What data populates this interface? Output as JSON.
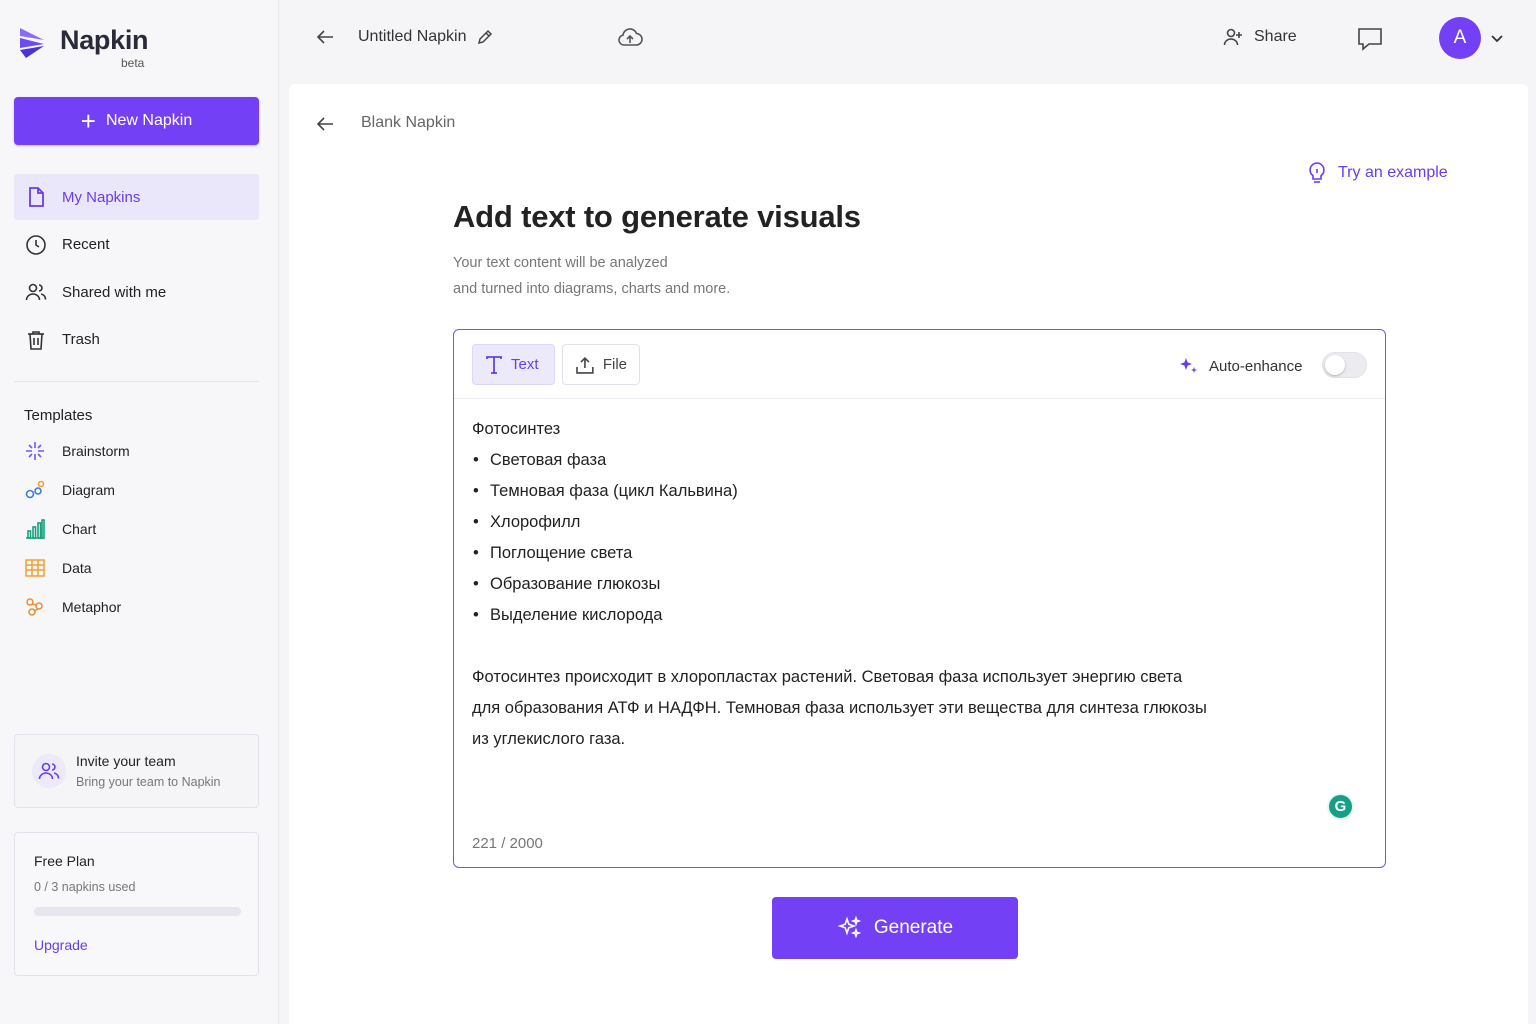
{
  "sidebar": {
    "logo": {
      "name": "Napkin",
      "badge": "beta"
    },
    "new_button": "New Napkin",
    "nav": [
      {
        "label": "My Napkins",
        "icon": "file-icon",
        "active": true
      },
      {
        "label": "Recent",
        "icon": "clock-icon"
      },
      {
        "label": "Shared with me",
        "icon": "users-icon"
      },
      {
        "label": "Trash",
        "icon": "trash-icon"
      }
    ],
    "templates": {
      "title": "Templates",
      "items": [
        {
          "label": "Brainstorm",
          "icon": "sparkle-icon",
          "color": "#6a5cf5"
        },
        {
          "label": "Diagram",
          "icon": "diagram-icon",
          "color": "#3a7fd6"
        },
        {
          "label": "Chart",
          "icon": "bar-chart-icon",
          "color": "#18a07a"
        },
        {
          "label": "Data",
          "icon": "table-icon",
          "color": "#f0a030"
        },
        {
          "label": "Metaphor",
          "icon": "metaphor-icon",
          "color": "#f08a30"
        }
      ]
    },
    "invite": {
      "title": "Invite your team",
      "subtitle": "Bring your team to Napkin"
    },
    "plan": {
      "title": "Free Plan",
      "usage": "0 / 3 napkins used",
      "progress": 0,
      "upgrade": "Upgrade"
    }
  },
  "topbar": {
    "doc_title": "Untitled Napkin",
    "share": "Share",
    "avatar_letter": "A"
  },
  "main": {
    "breadcrumb": "Blank Napkin",
    "try_example": "Try an example",
    "heading": "Add text to generate visuals",
    "sub_line1": "Your text content will be analyzed",
    "sub_line2": "and turned into diagrams, charts and more.",
    "editor": {
      "tab_text": "Text",
      "tab_file": "File",
      "auto_enhance": "Auto-enhance",
      "auto_enhance_on": false,
      "content": {
        "title": "Фотосинтез",
        "bullets": [
          "Световая фаза",
          "Темновая фаза (цикл Кальвина)",
          "Хлорофилл",
          "Поглощение света",
          "Образование глюкозы",
          "Выделение кислорода"
        ],
        "para_line1": "Фотосинтез происходит в хлоропластах растений. Световая фаза использует энергию света",
        "para_line2": "для образования АТФ и НАДФН. Темновая фаза использует эти вещества для синтеза глюкозы",
        "para_line3": "из углекислого газа."
      },
      "counter": "221 / 2000"
    },
    "generate": "Generate"
  },
  "colors": {
    "accent": "#7340f5",
    "accent_text": "#6a3cf0"
  }
}
